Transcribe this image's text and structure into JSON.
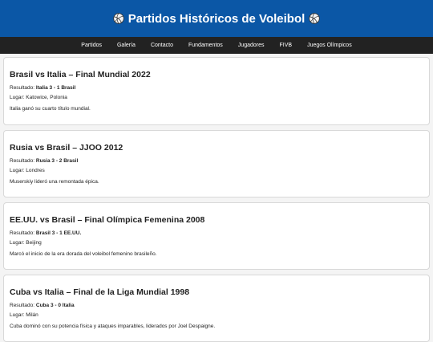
{
  "site": {
    "title": "Partidos Históricos de Voleibol"
  },
  "nav": [
    {
      "label": "Partidos"
    },
    {
      "label": "Galería"
    },
    {
      "label": "Contacto"
    },
    {
      "label": "Fundamentos"
    },
    {
      "label": "Jugadores"
    },
    {
      "label": "FIVB"
    },
    {
      "label": "Juegos Olímpicos"
    }
  ],
  "labels": {
    "result": "Resultado: ",
    "place": "Lugar: "
  },
  "matches": [
    {
      "title": "Brasil vs Italia – Final Mundial 2022",
      "result": "Italia 3 - 1 Brasil",
      "place": "Katowice, Polonia",
      "description": "Italia ganó su cuarto título mundial."
    },
    {
      "title": "Rusia vs Brasil – JJOO 2012",
      "result": "Rusia 3 - 2 Brasil",
      "place": "Londres",
      "description": "Muserskiy lideró una remontada épica."
    },
    {
      "title": "EE.UU. vs Brasil – Final Olímpica Femenina 2008",
      "result": "Brasil 3 - 1 EE.UU.",
      "place": "Beijing",
      "description": "Marcó el inicio de la era dorada del voleibol femenino brasileño."
    },
    {
      "title": "Cuba vs Italia – Final de la Liga Mundial 1998",
      "result": "Cuba 3 - 0 Italia",
      "place": "Milán",
      "description": "Cuba dominó con su potencia física y ataques imparables, liderados por Joel Despaigne."
    }
  ]
}
